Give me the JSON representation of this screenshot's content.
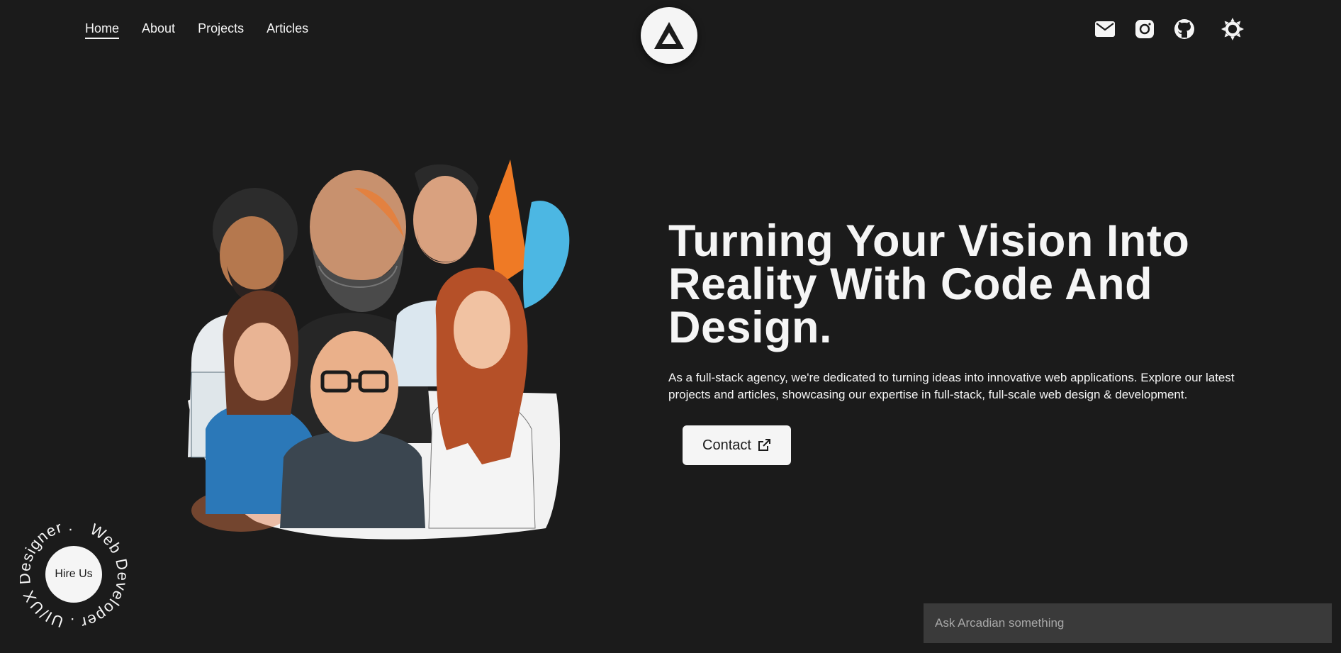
{
  "nav": {
    "links": [
      {
        "label": "Home",
        "active": true
      },
      {
        "label": "About",
        "active": false
      },
      {
        "label": "Projects",
        "active": false
      },
      {
        "label": "Articles",
        "active": false
      }
    ],
    "icons": [
      "mail-icon",
      "instagram-icon",
      "github-icon",
      "sun-icon"
    ]
  },
  "hero": {
    "title_line1": "Turning Your Vision Into",
    "title_line2": "Reality With Code And",
    "title_line3": "Design.",
    "description": "As a full-stack agency, we're dedicated to turning ideas into innovative web applications. Explore our latest projects and articles, showcasing our expertise in full-stack, full-scale web design & development.",
    "contact_label": "Contact"
  },
  "badge": {
    "ring_text": "Web Developer . UI/UX Designer .",
    "button_label": "Hire Us"
  },
  "chat": {
    "placeholder": "Ask Arcadian something"
  },
  "colors": {
    "background": "#1b1b1b",
    "foreground": "#f5f5f5",
    "input_bg": "#3a3a3a"
  }
}
